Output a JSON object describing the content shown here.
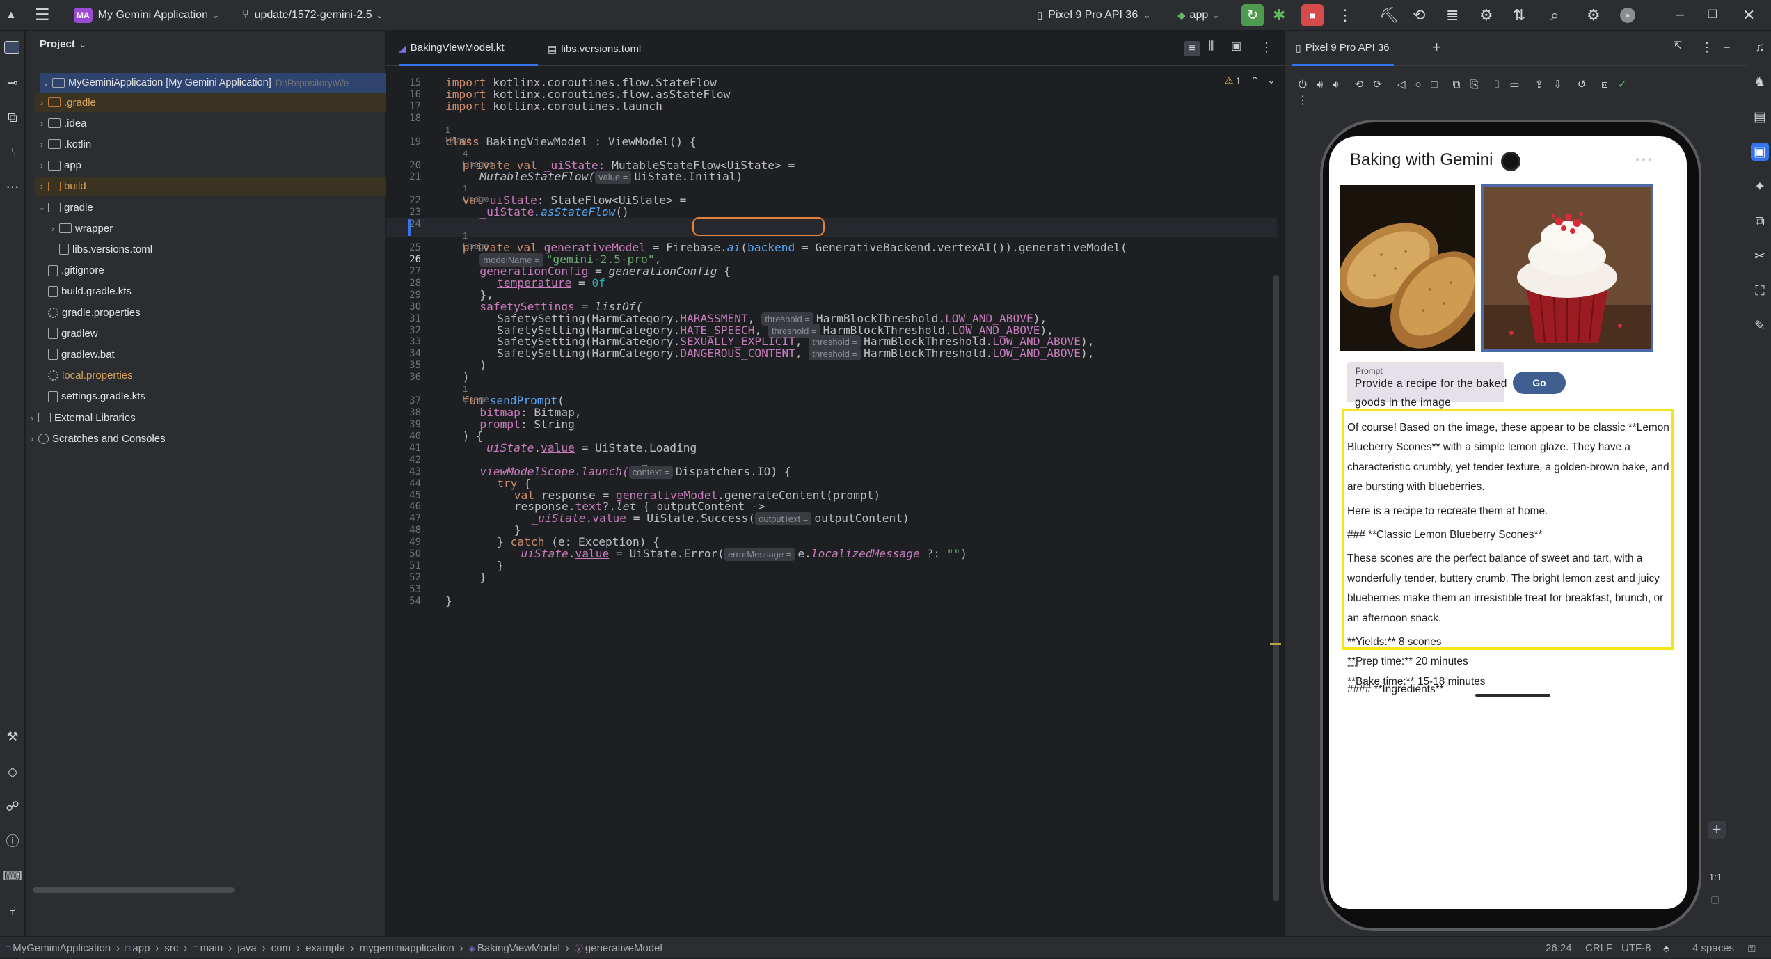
{
  "titlebar": {
    "project_badge": "MA",
    "project_name": "My Gemini Application",
    "branch": "update/1572-gemini-2.5",
    "device": "Pixel 9 Pro API 36",
    "run_config": "app"
  },
  "project_panel": {
    "title": "Project",
    "root_label": "MyGeminiApplication [My Gemini Application]",
    "root_path": "D:\\Repository\\We",
    "items": [
      {
        "label": ".gradle",
        "kind": "folder",
        "color": "orange"
      },
      {
        "label": ".idea",
        "kind": "folder",
        "color": "normal"
      },
      {
        "label": ".kotlin",
        "kind": "folder",
        "color": "normal"
      },
      {
        "label": "app",
        "kind": "folder",
        "color": "normal"
      },
      {
        "label": "build",
        "kind": "folder",
        "color": "orange"
      },
      {
        "label": "gradle",
        "kind": "folder",
        "color": "normal"
      },
      {
        "label": "wrapper",
        "kind": "folder",
        "color": "normal"
      },
      {
        "label": "libs.versions.toml",
        "kind": "file",
        "color": "normal"
      },
      {
        "label": ".gitignore",
        "kind": "file",
        "color": "normal"
      },
      {
        "label": "build.gradle.kts",
        "kind": "file",
        "color": "normal"
      },
      {
        "label": "gradle.properties",
        "kind": "gear",
        "color": "normal"
      },
      {
        "label": "gradlew",
        "kind": "file",
        "color": "normal"
      },
      {
        "label": "gradlew.bat",
        "kind": "file",
        "color": "normal"
      },
      {
        "label": "local.properties",
        "kind": "gear",
        "color": "orange"
      },
      {
        "label": "settings.gradle.kts",
        "kind": "file",
        "color": "normal"
      },
      {
        "label": "External Libraries",
        "kind": "lib",
        "color": "normal"
      },
      {
        "label": "Scratches and Consoles",
        "kind": "scratch",
        "color": "normal"
      }
    ]
  },
  "editor": {
    "tabs": [
      {
        "label": "BakingViewModel.kt",
        "active": true
      },
      {
        "label": "libs.versions.toml",
        "active": false
      }
    ],
    "warnings": "1",
    "line_numbers": [
      "15",
      "16",
      "17",
      "18",
      "19",
      "20",
      "21",
      "22",
      "23",
      "24",
      "25",
      "26",
      "27",
      "28",
      "29",
      "30",
      "31",
      "32",
      "33",
      "34",
      "35",
      "36",
      "37",
      "38",
      "39",
      "40",
      "41",
      "42",
      "43",
      "44",
      "45",
      "46",
      "47",
      "48",
      "49",
      "50",
      "51",
      "52",
      "53",
      "54"
    ],
    "usages": {
      "u19": "1 Usage",
      "u20": "4 Usages",
      "u22": "1 Usage",
      "u25": "1 Usage",
      "u37": "1 Usage"
    },
    "code": {
      "l15_kw": "import",
      "l15": " kotlinx.coroutines.flow.StateFlow",
      "l16_kw": "import",
      "l16": " kotlinx.coroutines.flow.asStateFlow",
      "l17_kw": "import",
      "l17": " kotlinx.coroutines.launch",
      "l19_kw": "class",
      "l19": " BakingViewModel : ViewModel() {",
      "l20_kw": "private val",
      "l20_prop": "_uiState",
      "l20": ": MutableStateFlow<UiState> =",
      "l21_fn": "MutableStateFlow(",
      "l21_hint": "value =",
      "l21": "UiState.Initial)",
      "l22_kw": "val",
      "l22_prop": "uiState",
      "l22": ": StateFlow<UiState> =",
      "l23_prop": "_uiState",
      "l23_fn": ".asStateFlow",
      "l23": "()",
      "l25_kw": "private val",
      "l25_prop": "generativeModel",
      "l25_a": " = Firebase.",
      "l25_fn": "ai",
      "l25_b": "(",
      "l25_c": "backend",
      "l25_d": " = GenerativeBackend.vertexAI()).generativeModel(",
      "l26_hint": "modelName =",
      "l26_str": "\"gemini-2.5-pro\"",
      "l26": ",",
      "l27_prop": "generationConfig",
      "l27_a": " = ",
      "l27_fn": "generationConfig",
      "l27": " {",
      "l28_prop": "temperature",
      "l28": " = ",
      "l28_num": "0f",
      "l29": "},",
      "l30_prop": "safetySettings",
      "l30": " = ",
      "l30_fn": "listOf(",
      "l31_a": "SafetySetting(HarmCategory.",
      "l31_p": "HARASSMENT",
      "l31_hint": "threshold =",
      "l31_b": "HarmBlockThreshold.",
      "l31_c": "LOW_AND_ABOVE",
      "l32_a": "SafetySetting(HarmCategory.",
      "l32_p": "HATE_SPEECH",
      "l32_hint": "threshold =",
      "l32_b": "HarmBlockThreshold.",
      "l32_c": "LOW_AND_ABOVE",
      "l33_a": "SafetySetting(HarmCategory.",
      "l33_p": "SEXUALLY_EXPLICIT",
      "l33_hint": "threshold =",
      "l33_b": "HarmBlockThreshold.",
      "l33_c": "LOW_AND_ABOVE",
      "l34_a": "SafetySetting(HarmCategory.",
      "l34_p": "DANGEROUS_CONTENT",
      "l34_hint": "threshold =",
      "l34_b": "HarmBlockThreshold.",
      "l34_c": "LOW_AND_ABOVE",
      "l35": ")",
      "l36": ")",
      "l37_kw": "fun",
      "l37_fn": "sendPrompt",
      "l37": "(",
      "l38_prop": "bitmap",
      "l38": ": Bitmap,",
      "l39_prop": "prompt",
      "l39": ": String",
      "l40": ") {",
      "l41_prop": "_uiState",
      "l41_a": ".",
      "l41_p": "value",
      "l41": " = UiState.Loading",
      "l43_fn": "viewModelScope.launch(",
      "l43_hint": "context =",
      "l43": "Dispatchers.IO) {",
      "l44_kw": "try",
      "l44": " {",
      "l45_kw": "val",
      "l45_a": " response = ",
      "l45_prop": "generativeModel",
      "l45": ".generateContent(prompt)",
      "l46_a": "response.",
      "l46_p": "text",
      "l46_b": "?.",
      "l46_fn": "let",
      "l46": " { outputContent ->",
      "l47_prop": "_uiState",
      "l47_a": ".",
      "l47_p": "value",
      "l47_b": " = UiState.Success(",
      "l47_hint": "outputText =",
      "l47": "outputContent)",
      "l48": "}",
      "l49_a": "} ",
      "l49_kw": "catch",
      "l49": " (e: Exception) {",
      "l50_prop": "_uiState",
      "l50_a": ".",
      "l50_p": "value",
      "l50_b": " = UiState.Error(",
      "l50_hint": "errorMessage =",
      "l50_c": "e.",
      "l50_fn": "localizedMessage",
      "l50_d": " ?: ",
      "l50_str": "\"\"",
      "l50": ")",
      "l51": "}",
      "l52": "}",
      "l54": "}"
    }
  },
  "device_panel": {
    "tab_label": "Pixel 9 Pro API 36",
    "app_title": "Baking with Gemini",
    "prompt_label": "Prompt",
    "prompt_value": "Provide a recipe for the baked goods in the image",
    "go_label": "Go",
    "result_paragraphs": [
      "Of course! Based on the image, these appear to be classic **Lemon Blueberry Scones** with a simple lemon glaze. They have a characteristic crumbly, yet tender texture, a golden-brown bake, and are bursting with blueberries.",
      "Here is a recipe to recreate them at home.",
      "### **Classic Lemon Blueberry Scones**",
      "These scones are the perfect balance of sweet and tart, with a wonderfully tender, buttery crumb. The bright lemon zest and juicy blueberries make them an irresistible treat for breakfast, brunch, or an afternoon snack.",
      "**Yields:** 8 scones\n**Prep time:** 20 minutes\n**Bake time:** 15-18 minutes"
    ],
    "after_separator": "---",
    "after_heading": "#### **Ingredients**",
    "zoom_label": "1:1",
    "plus_label": "+"
  },
  "statusbar": {
    "crumbs": [
      "MyGeminiApplication",
      "app",
      "src",
      "main",
      "java",
      "com",
      "example",
      "mygeminiapplication",
      "BakingViewModel",
      "generativeModel"
    ],
    "position": "26:24",
    "line_sep": "CRLF",
    "encoding": "UTF-8",
    "indent": "4 spaces"
  },
  "colors": {
    "accent": "#3574f0",
    "highlight_orange": "#e0823d",
    "result_border": "#f7e51a",
    "go_button": "#3f5f90"
  }
}
